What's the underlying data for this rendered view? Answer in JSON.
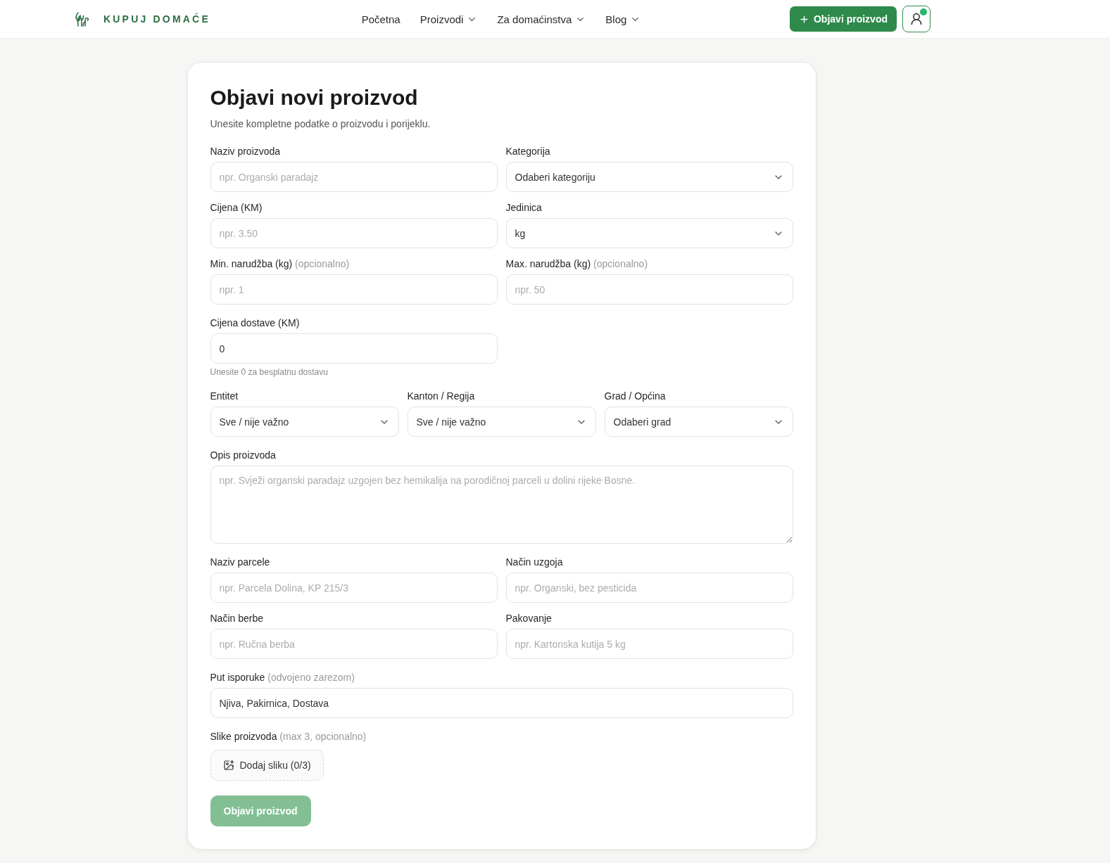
{
  "header": {
    "logo": "KUPUJ DOMAĆE",
    "nav": [
      {
        "label": "Početna",
        "dropdown": false
      },
      {
        "label": "Proizvodi",
        "dropdown": true
      },
      {
        "label": "Za domaćinstva",
        "dropdown": true
      },
      {
        "label": "Blog",
        "dropdown": true
      }
    ],
    "publish_button": "Objavi proizvod",
    "user": {
      "online": true
    }
  },
  "form": {
    "title": "Objavi novi proizvod",
    "subtitle": "Unesite kompletne podatke o proizvodu i porijeklu.",
    "product_fields": [
      {
        "kind": "text",
        "label": "Naziv proizvoda",
        "placeholder": "npr. Organski paradajz"
      },
      {
        "kind": "select",
        "label": "Kategorija",
        "value": "Odaberi kategoriju"
      },
      {
        "kind": "text",
        "label": "Cijena (KM)",
        "placeholder": "npr. 3.50"
      },
      {
        "kind": "select",
        "label": "Jedinica",
        "value": "kg"
      },
      {
        "kind": "text",
        "label": "Min. narudžba (kg)",
        "note": "(opcionalno)",
        "placeholder": "npr. 1"
      },
      {
        "kind": "text",
        "label": "Max. narudžba (kg)",
        "note": "(opcionalno)",
        "placeholder": "npr. 50"
      }
    ],
    "delivery_price": {
      "kind": "text",
      "label": "Cijena dostave (KM)",
      "value": "0",
      "help": "Unesite 0 za besplatnu dostavu"
    },
    "location_fields": [
      {
        "kind": "select",
        "label": "Entitet",
        "value": "Sve / nije važno"
      },
      {
        "kind": "select",
        "label": "Kanton / Regija",
        "value": "Sve / nije važno"
      },
      {
        "kind": "select",
        "label": "Grad / Općina",
        "value": "Odaberi grad"
      }
    ],
    "description": {
      "kind": "textarea",
      "label": "Opis proizvoda",
      "placeholder": "npr. Svježi organski paradajz uzgojen bez hemikalija na porodičnoj parceli u dolini rijeke Bosne."
    },
    "origin_fields": [
      {
        "kind": "text",
        "label": "Naziv parcele",
        "placeholder": "npr. Parcela Dolina, KP 215/3"
      },
      {
        "kind": "text",
        "label": "Način uzgoja",
        "placeholder": "npr. Organski, bez pesticida"
      },
      {
        "kind": "text",
        "label": "Način berbe",
        "placeholder": "npr. Ručna berba"
      },
      {
        "kind": "text",
        "label": "Pakovanje",
        "placeholder": "npr. Kartonska kutija 5 kg"
      }
    ],
    "delivery_route": {
      "kind": "text",
      "label": "Put isporuke",
      "note": "(odvojeno zarezom)",
      "value": "Njiva, Pakirnica, Dostava"
    },
    "images": {
      "label": "Slike proizvoda",
      "note": "(max 3, opcionalno)",
      "add_button": "Dodaj sliku (0/3)"
    },
    "submit": {
      "label": "Objavi proizvod",
      "disabled": true
    }
  }
}
